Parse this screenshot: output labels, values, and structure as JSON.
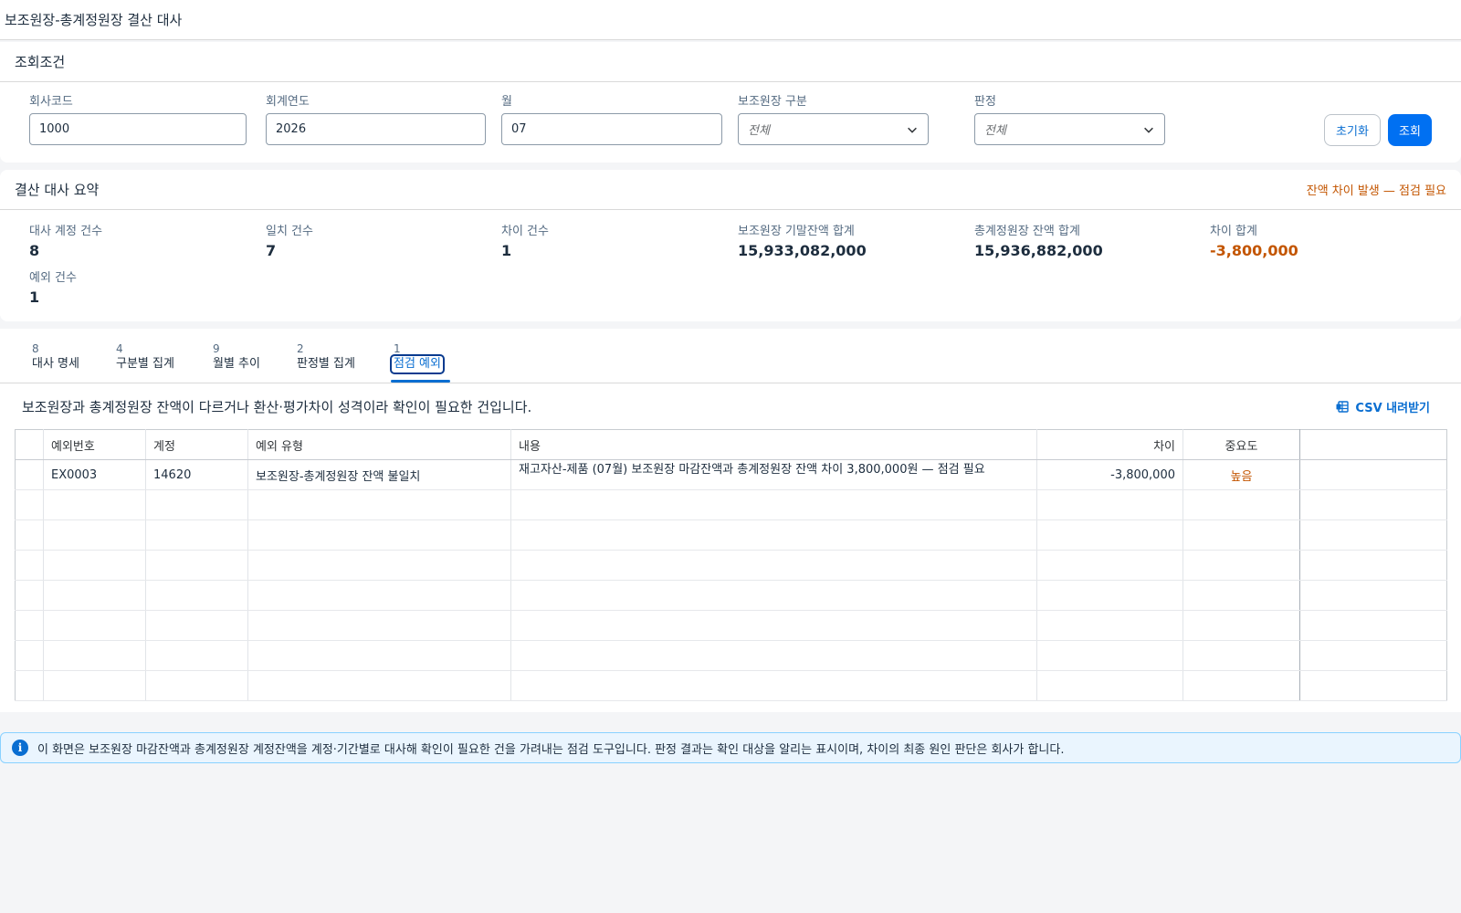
{
  "page": {
    "title": "보조원장-총계정원장 결산 대사"
  },
  "filter": {
    "heading": "조회조건",
    "company_code": {
      "label": "회사코드",
      "value": "1000"
    },
    "fiscal_year": {
      "label": "회계연도",
      "value": "2026"
    },
    "month": {
      "label": "월",
      "value": "07"
    },
    "subledger_type": {
      "label": "보조원장 구분",
      "value": "전체"
    },
    "judgement": {
      "label": "판정",
      "value": "전체"
    },
    "reset_label": "초기화",
    "search_label": "조회"
  },
  "summary": {
    "heading": "결산 대사 요약",
    "warning": "잔액 차이 발생 — 점검 필요",
    "metrics": [
      {
        "label": "대사 계정 건수",
        "value": "8"
      },
      {
        "label": "일치 건수",
        "value": "7"
      },
      {
        "label": "차이 건수",
        "value": "1"
      },
      {
        "label": "보조원장 기말잔액 합계",
        "value": "15,933,082,000"
      },
      {
        "label": "총계정원장 잔액 합계",
        "value": "15,936,882,000"
      },
      {
        "label": "차이 합계",
        "value": "-3,800,000"
      },
      {
        "label": "예외 건수",
        "value": "1"
      }
    ]
  },
  "tabs": [
    {
      "count": "8",
      "label": "대사 명세"
    },
    {
      "count": "4",
      "label": "구분별 집계"
    },
    {
      "count": "9",
      "label": "월별 추이"
    },
    {
      "count": "2",
      "label": "판정별 집계"
    },
    {
      "count": "1",
      "label": "점검 예외"
    }
  ],
  "exceptions": {
    "description": "보조원장과 총계정원장 잔액이 다르거나 환산·평가차이 성격이라 확인이 필요한 건입니다.",
    "csv_label": "CSV 내려받기",
    "columns": {
      "id": "예외번호",
      "account": "계정",
      "type": "예외 유형",
      "content": "내용",
      "diff": "차이",
      "severity": "중요도"
    },
    "rows": [
      {
        "id": "EX0003",
        "account": "14620",
        "type": "보조원장-총계정원장 잔액 불일치",
        "content": "재고자산-제품 (07월) 보조원장 마감잔액과 총계정원장 잔액 차이 3,800,000원 — 점검 필요",
        "diff": "-3,800,000",
        "severity": "높음"
      }
    ]
  },
  "info": {
    "text": "이 화면은 보조원장 마감잔액과 총계정원장 계정잔액을 계정·기간별로 대사해 확인이 필요한 건을 가려내는 점검 도구입니다. 판정 결과는 확인 대상을 알리는 표시이며, 차이의 최종 원인 판단은 회사가 합니다."
  },
  "colors": {
    "accent": "#0070f2",
    "warning": "#c35500",
    "info_bg": "#eaf5fe"
  },
  "icons": {
    "select": "chevron-down-icon",
    "csv": "spreadsheet-icon",
    "info": "info-icon"
  }
}
